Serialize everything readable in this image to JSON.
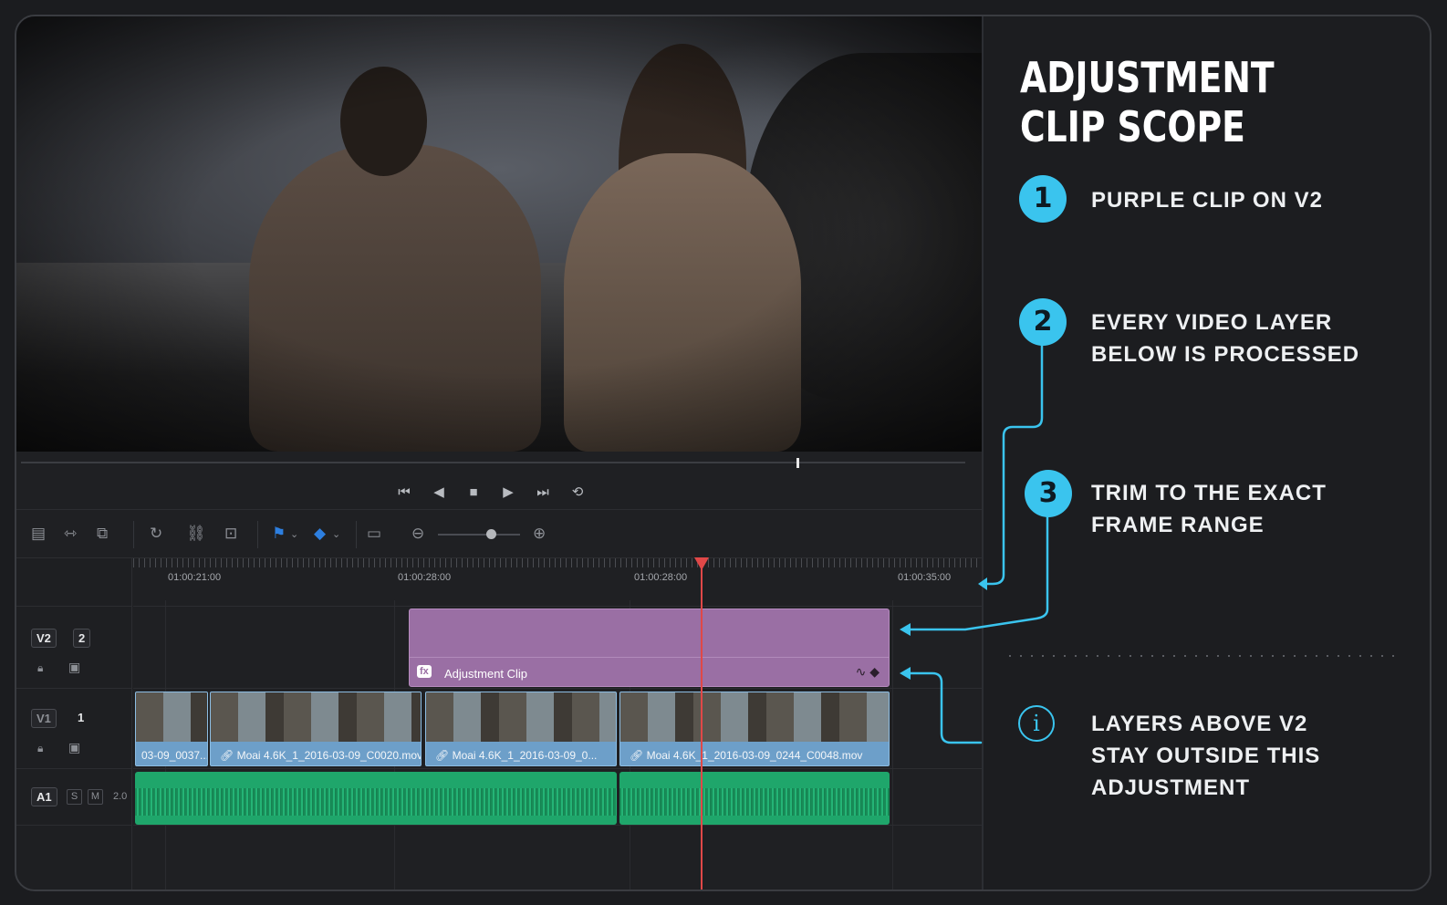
{
  "viewer": {
    "description_icon": "video-preview"
  },
  "transport": {
    "buttons": [
      "⏮",
      "◀",
      "■",
      "▶",
      "⏭",
      "⟲"
    ]
  },
  "toolbar": {
    "icons": [
      "timeline-view-icon",
      "trim-icon",
      "blade-icon",
      "snap-icon",
      "link-icon",
      "lock-icon",
      "flag-icon",
      "marker-icon",
      "clip-view-icon",
      "zoom-out-icon",
      "zoom-in-icon"
    ]
  },
  "ruler": {
    "timecodes": [
      "01:00:21:00",
      "01:00:28:00",
      "01:00:28:00",
      "01:00:35:00"
    ]
  },
  "tracks": {
    "v2": {
      "name": "V2",
      "number": "2"
    },
    "v1": {
      "name": "V1",
      "number": "1"
    },
    "a1": {
      "name": "A1",
      "solo": "S",
      "mute": "M",
      "level": "2.0"
    }
  },
  "clips": {
    "adjustment": {
      "fx": "fx",
      "label": "Adjustment Clip"
    },
    "video": [
      {
        "name": "03-09_0037..."
      },
      {
        "name": "Moai 4.6K_1_2016-03-09_C0020.mov"
      },
      {
        "name": "Moai 4.6K_1_2016-03-09_0..."
      },
      {
        "name": "Moai 4.6K_1_2016-03-09_0244_C0048.mov"
      }
    ]
  },
  "panel": {
    "title": "ADJUSTMENT CLIP SCOPE",
    "steps": [
      {
        "num": "1",
        "text": "PURPLE CLIP ON V2"
      },
      {
        "num": "2",
        "text": "EVERY VIDEO LAYER BELOW IS PROCESSED"
      },
      {
        "num": "3",
        "text": "TRIM TO THE EXACT FRAME RANGE"
      }
    ],
    "info": {
      "icon": "i",
      "text": "LAYERS ABOVE V2 STAY OUTSIDE THIS ADJUSTMENT"
    }
  },
  "colors": {
    "accent": "#3ac4ee",
    "adjustment_clip": "#9a6fa4",
    "video_clip": "#6d9fc9",
    "audio_clip": "#1fa66b",
    "playhead": "#e04848"
  }
}
